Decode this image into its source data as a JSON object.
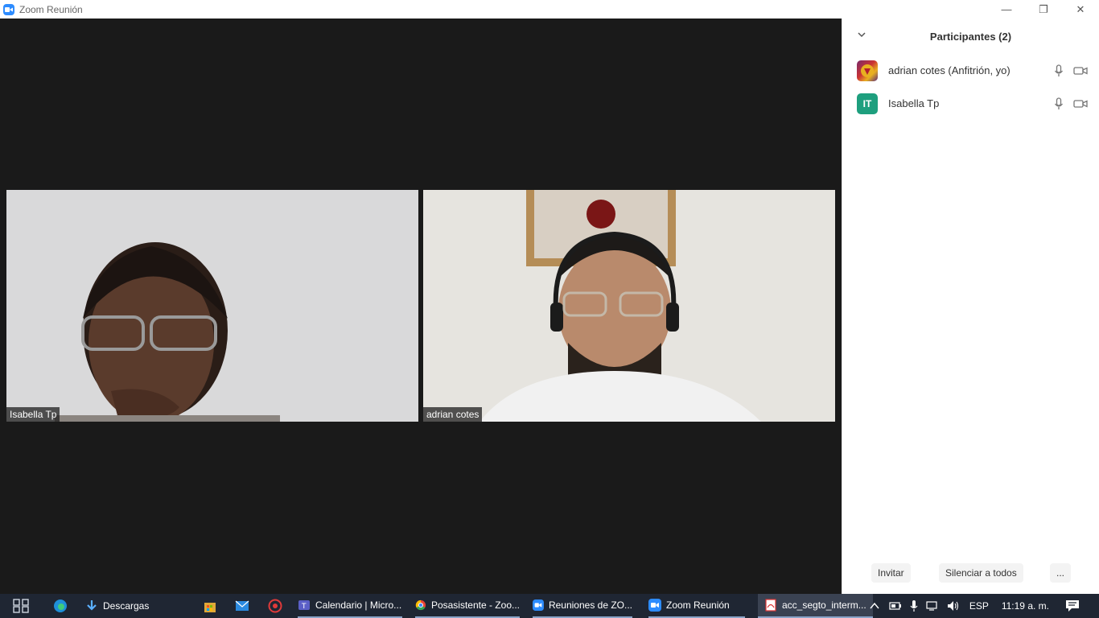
{
  "window": {
    "title": "Zoom Reunión",
    "controls": {
      "minimize": "—",
      "restore": "❐",
      "close": "✕"
    }
  },
  "videos": [
    {
      "name": "Isabella Tp"
    },
    {
      "name": "adrian cotes"
    }
  ],
  "sidebar": {
    "title": "Participantes (2)",
    "participants": [
      {
        "name": "adrian cotes (Anfitrión, yo)",
        "avatar": "image"
      },
      {
        "name": "Isabella Tp",
        "avatar_initials": "IT"
      }
    ],
    "footer": {
      "invite": "Invitar",
      "mute_all": "Silenciar a todos",
      "more": "..."
    }
  },
  "taskbar": {
    "items": [
      {
        "label": "Descargas"
      },
      {
        "label": "Calendario | Micro..."
      },
      {
        "label": "Posasistente - Zoo..."
      },
      {
        "label": "Reuniones de ZO..."
      },
      {
        "label": "Zoom Reunión"
      },
      {
        "label": "acc_segto_interm..."
      }
    ],
    "tray": {
      "language": "ESP",
      "time": "11:19 a. m."
    }
  },
  "colors": {
    "zoom_blue": "#2D8CFF",
    "avatar_it": "#1e9f7e",
    "taskbar_bg": "#1f2633"
  }
}
